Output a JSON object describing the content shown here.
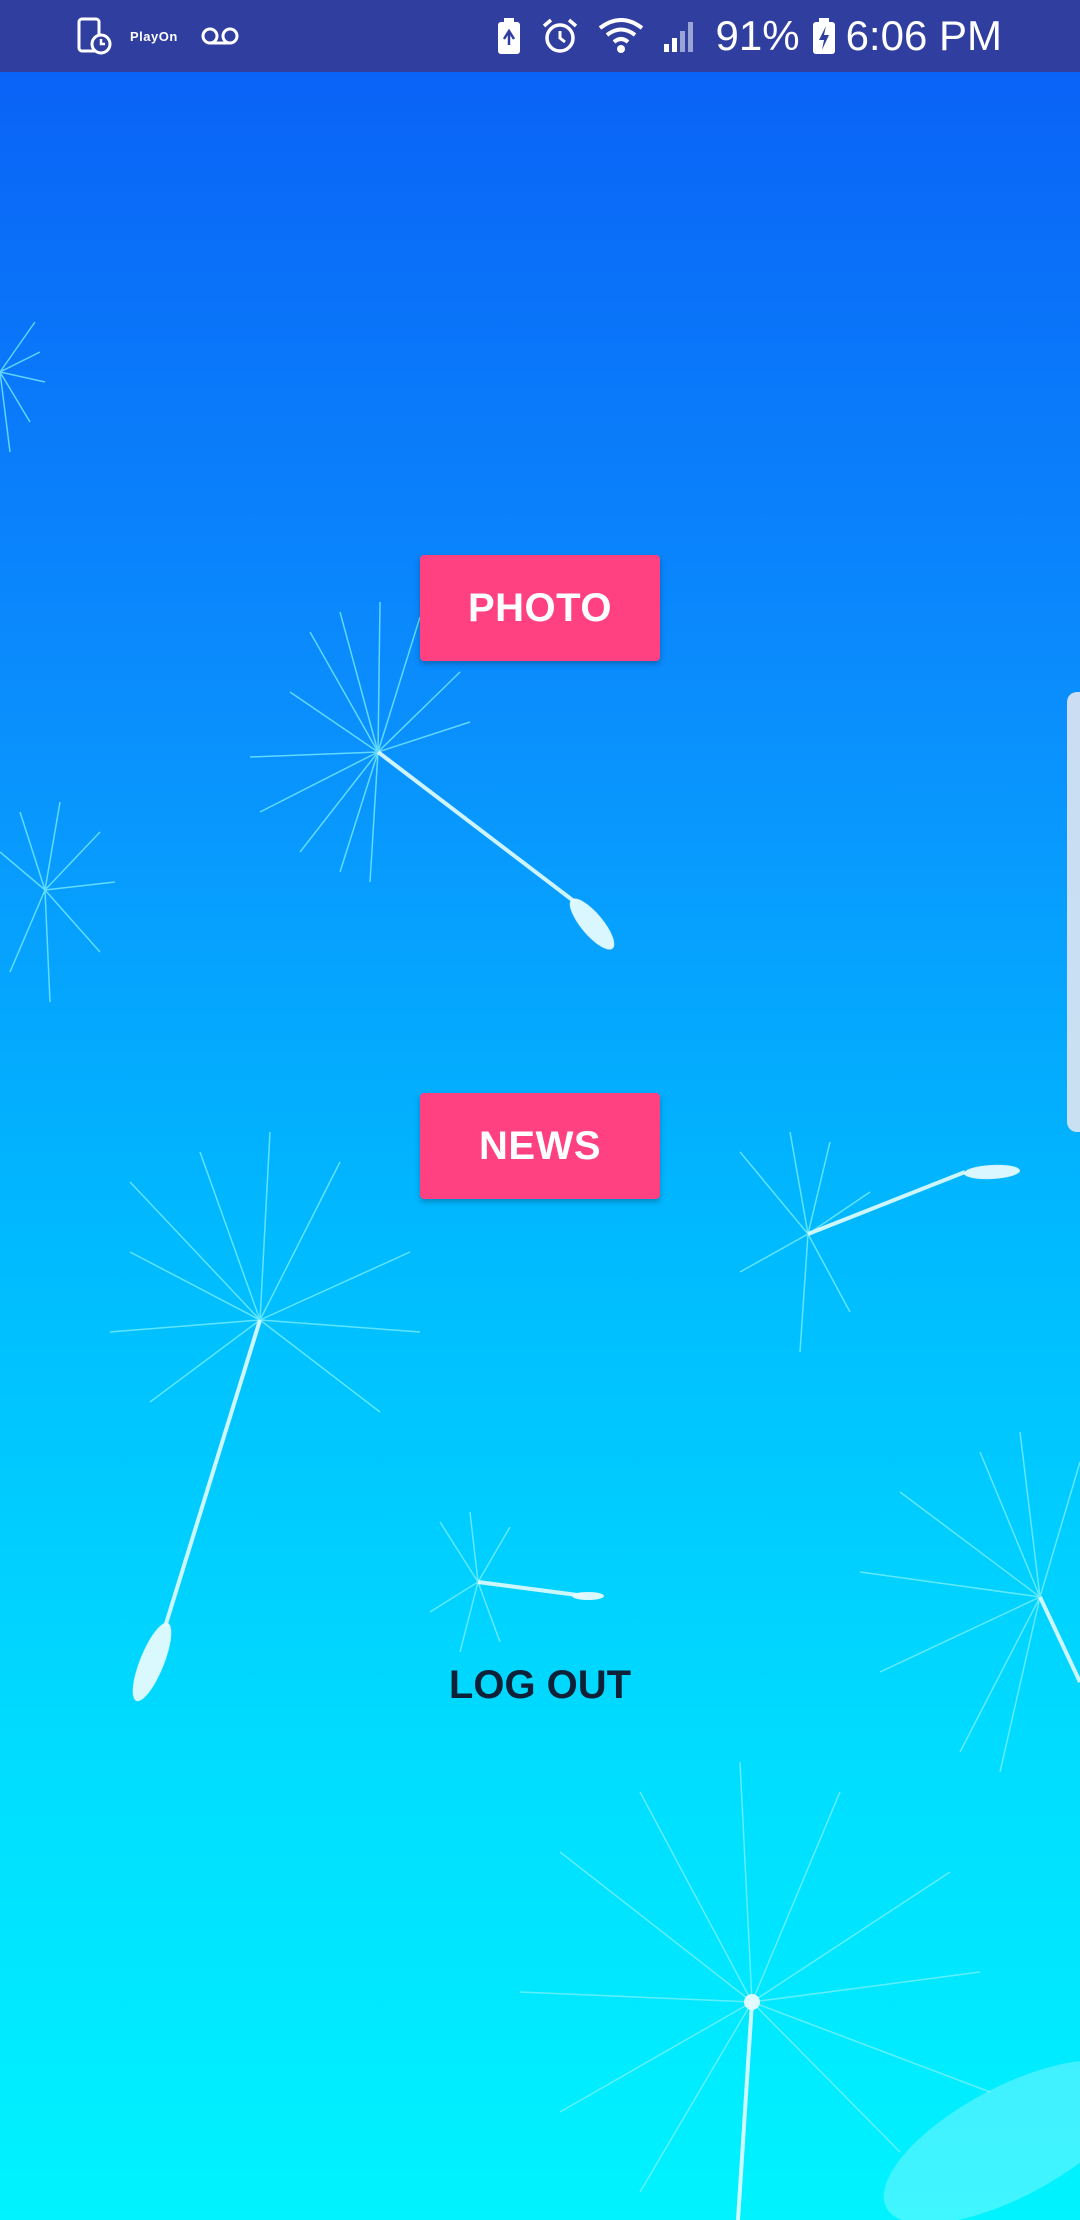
{
  "status_bar": {
    "left_icons": [
      "screen-timer-icon",
      "playon-icon",
      "voicemail-icon"
    ],
    "playon_text": "PlayOn",
    "right_icons": [
      "battery-saver-icon",
      "alarm-icon",
      "wifi-icon",
      "signal-icon",
      "battery-charging-icon"
    ],
    "battery_percent": "91%",
    "time": "6:06 PM",
    "background_color": "#303f9f"
  },
  "main": {
    "photo_button_label": "PHOTO",
    "news_button_label": "NEWS",
    "logout_button_label": "LOG OUT",
    "accent_color": "#ff4081",
    "background_top_color": "#0a63f7",
    "background_bottom_color": "#00f3ff"
  }
}
